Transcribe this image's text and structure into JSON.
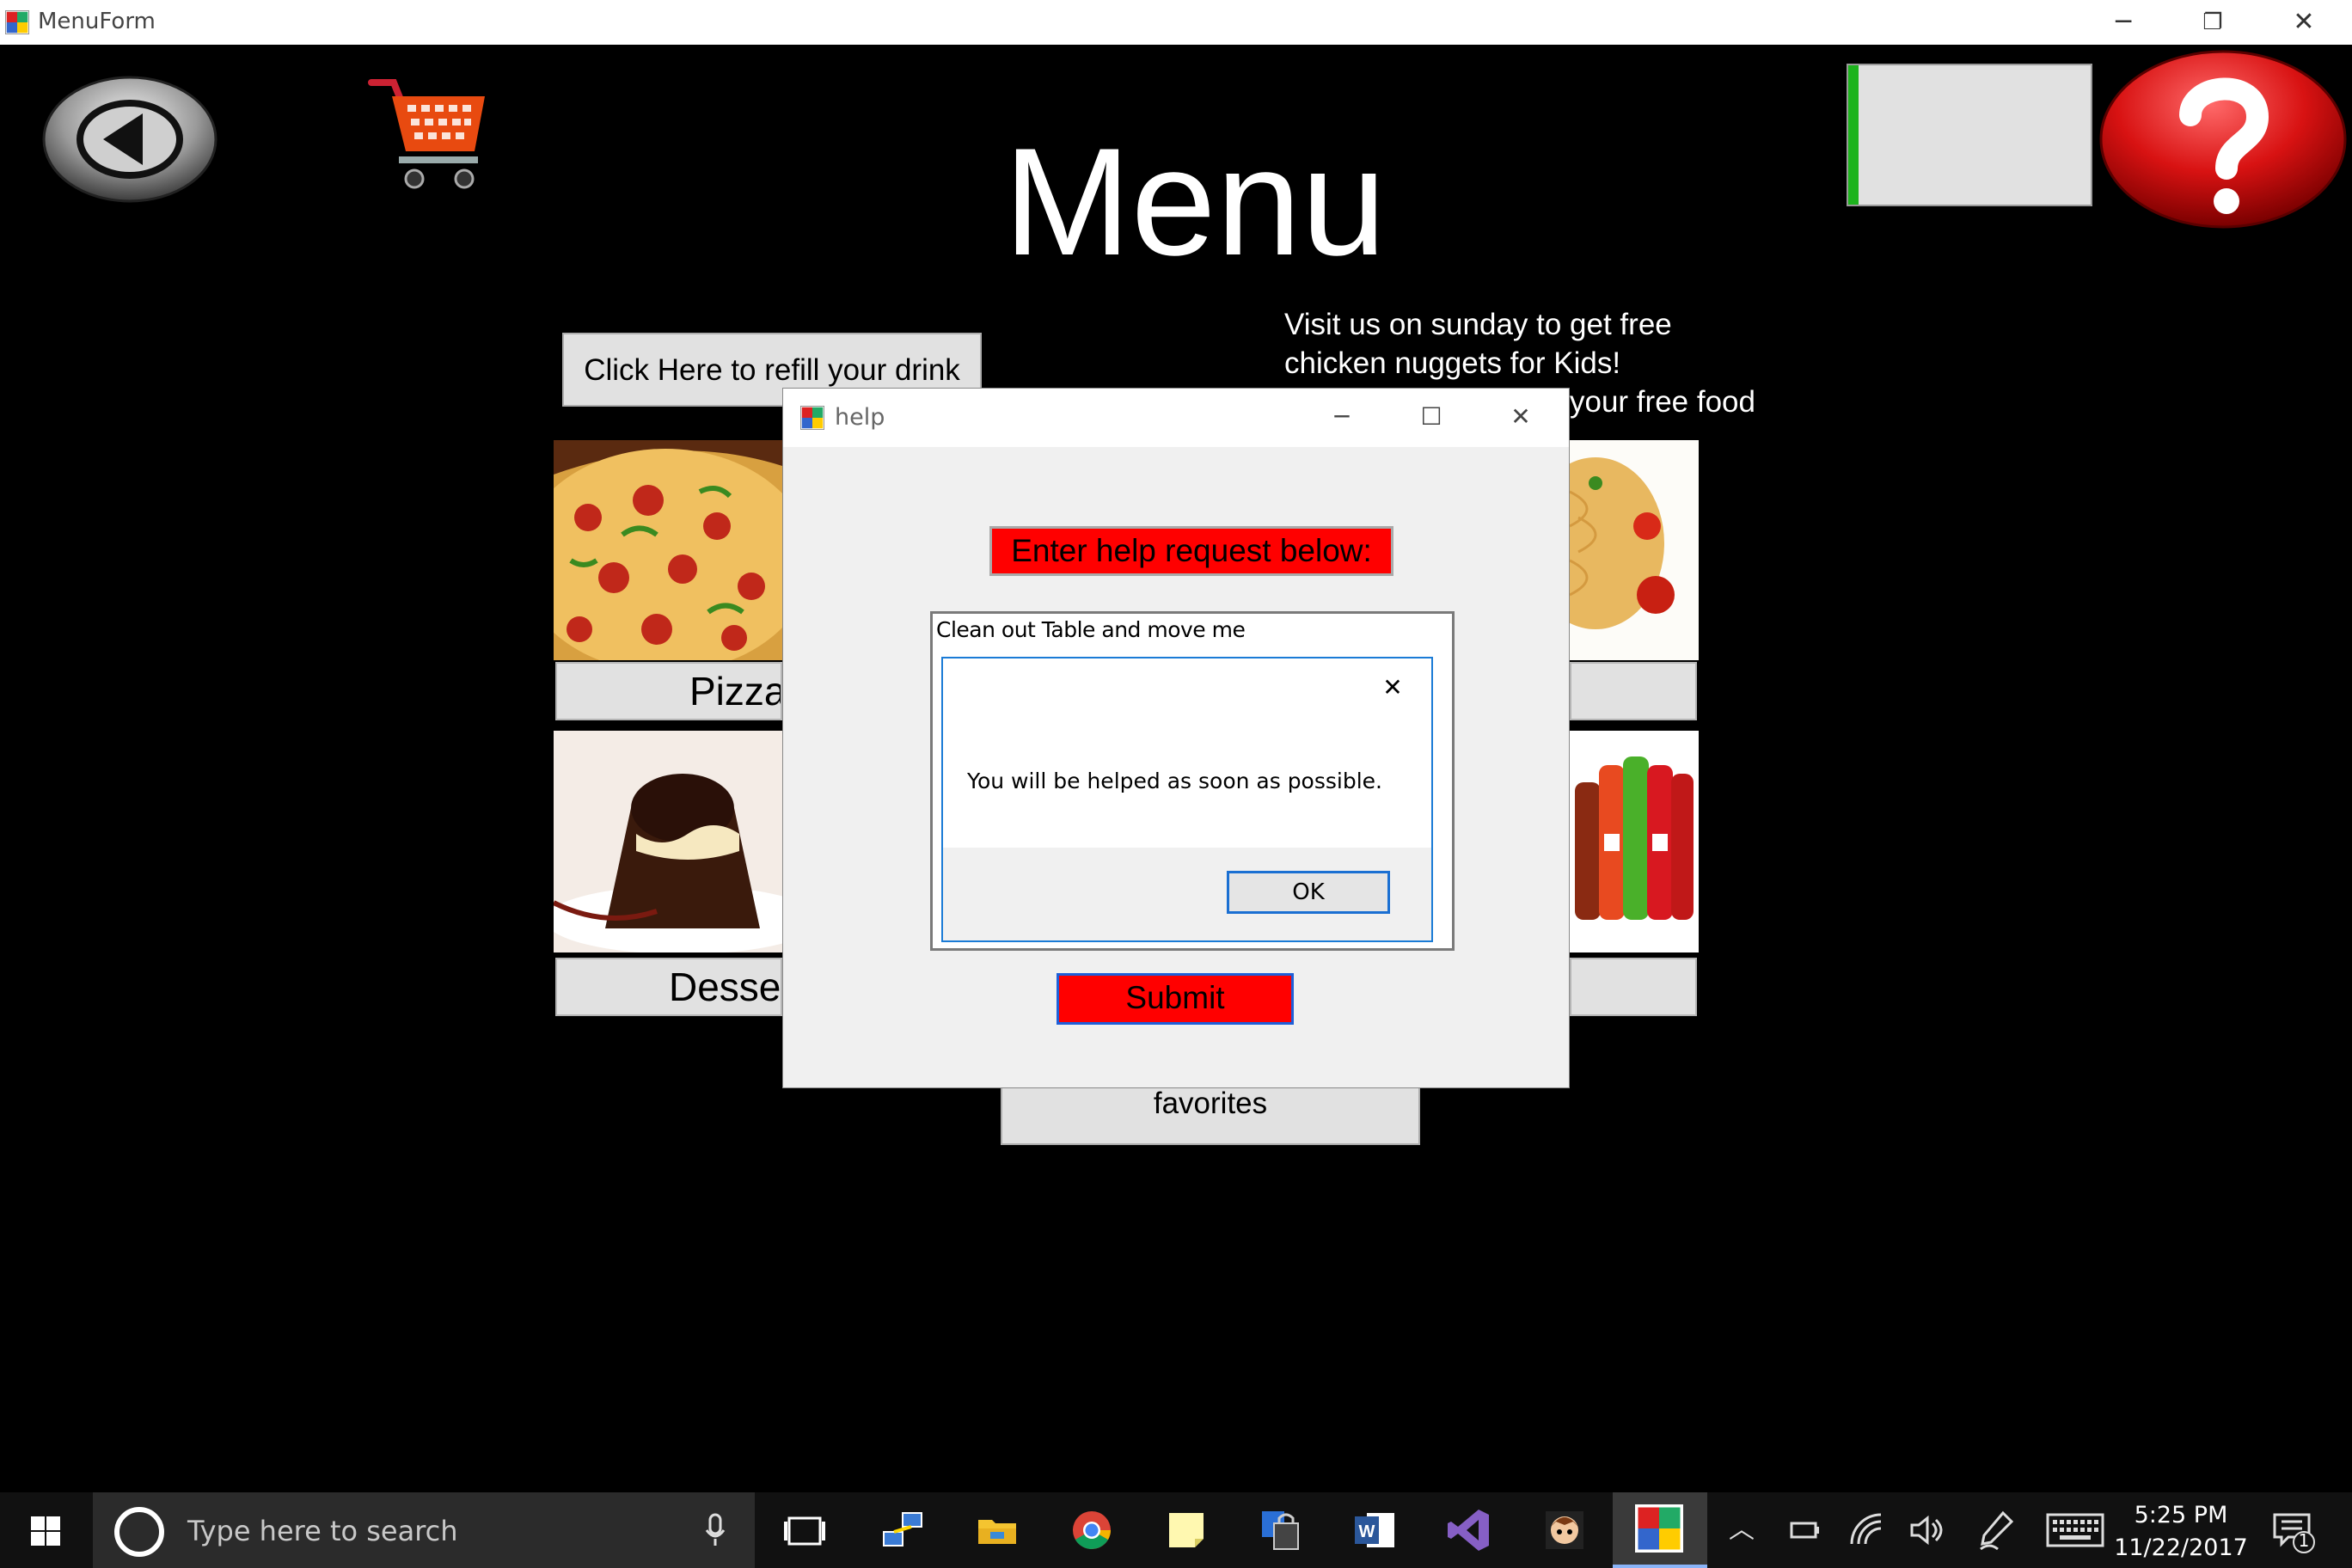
{
  "window": {
    "title": "MenuForm",
    "minimize": "─",
    "restore": "❐",
    "close": "✕"
  },
  "main": {
    "title": "Menu",
    "refill_button": "Click Here to refill your drink",
    "promo_lines": [
      "Visit us on sunday to get free",
      "chicken nuggets for Kids!",
      "your free food"
    ],
    "categories": [
      {
        "label": "Pizza",
        "visible": "Pizza"
      },
      {
        "label": "Dessert",
        "visible": "Desse"
      }
    ],
    "favorites_button": "favorites",
    "icons": {
      "back": "back-arrow-icon",
      "cart": "shopping-cart-icon",
      "help": "help-question-icon"
    },
    "colors": {
      "help_red": "#e01515",
      "status_green": "#1db31d"
    }
  },
  "help_dialog": {
    "title": "help",
    "minimize": "─",
    "maximize": "☐",
    "close": "✕",
    "prompt": "Enter help request below:",
    "request_text": "Clean out Table and move me",
    "submit": "Submit",
    "colors": {
      "red": "#ff0000"
    }
  },
  "message_box": {
    "text": "You will be helped as soon as possible.",
    "close": "✕",
    "ok": "OK"
  },
  "taskbar": {
    "search_placeholder": "Type here to search",
    "time": "5:25 PM",
    "date": "11/22/2017",
    "notification_count": "1"
  }
}
